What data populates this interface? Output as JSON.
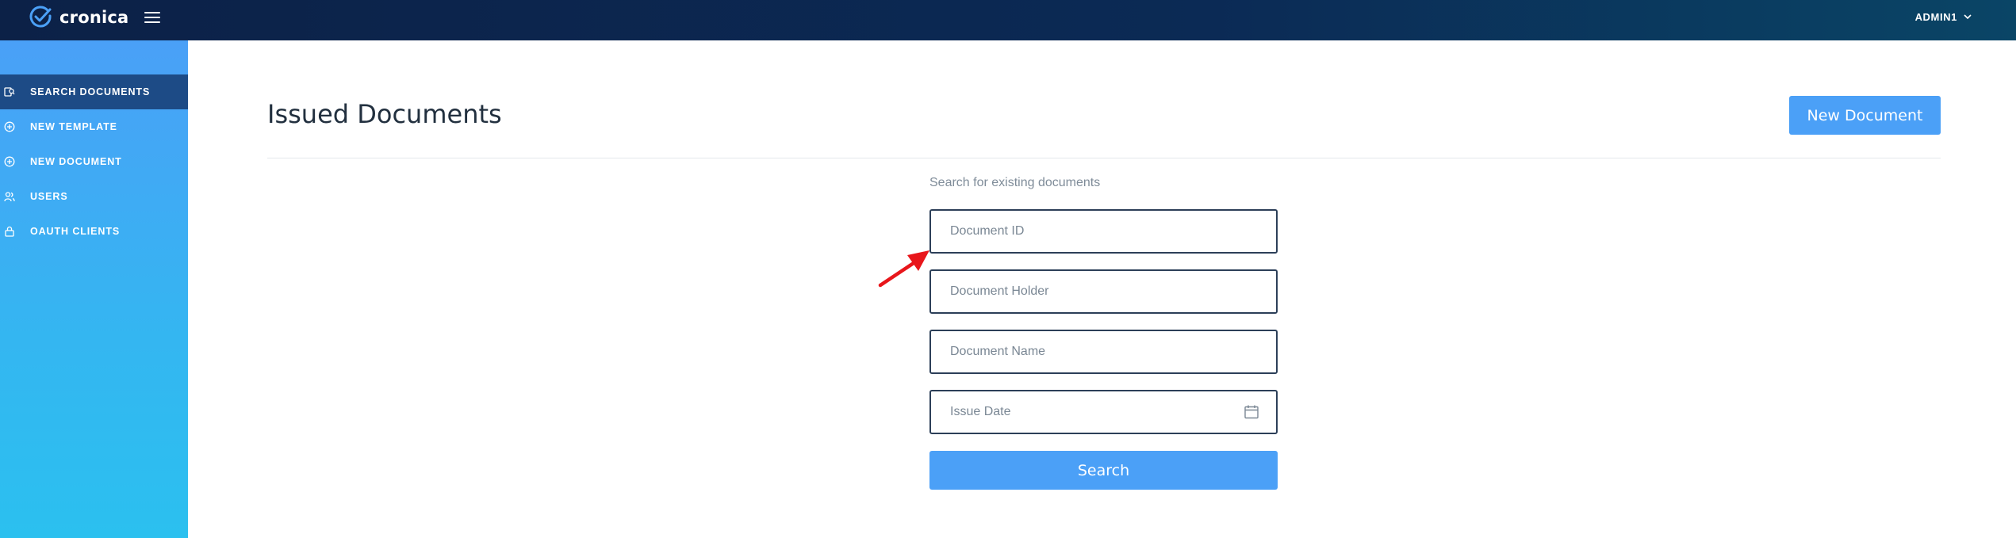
{
  "header": {
    "brand_name": "cronica",
    "user_label": "ADMIN1"
  },
  "sidebar": {
    "items": [
      {
        "label": "SEARCH DOCUMENTS",
        "icon": "search-documents-icon",
        "active": true
      },
      {
        "label": "NEW TEMPLATE",
        "icon": "plus-circle-icon",
        "active": false
      },
      {
        "label": "NEW DOCUMENT",
        "icon": "plus-circle-icon",
        "active": false
      },
      {
        "label": "USERS",
        "icon": "users-icon",
        "active": false
      },
      {
        "label": "OAUTH CLIENTS",
        "icon": "lock-icon",
        "active": false
      }
    ]
  },
  "main": {
    "title": "Issued Documents",
    "new_document_label": "New Document",
    "search_caption": "Search for existing documents",
    "fields": {
      "document_id": {
        "placeholder": "Document ID",
        "value": ""
      },
      "document_holder": {
        "placeholder": "Document Holder",
        "value": ""
      },
      "document_name": {
        "placeholder": "Document Name",
        "value": ""
      },
      "issue_date": {
        "placeholder": "Issue Date",
        "value": ""
      }
    },
    "search_label": "Search"
  },
  "colors": {
    "topbar": "#0c2147",
    "sidebar_top": "#4aa0f7",
    "sidebar_bottom": "#2bc0ef",
    "sidebar_active": "#1d4b86",
    "primary_button": "#4ba0f7",
    "annotation_arrow": "#e8161b"
  }
}
